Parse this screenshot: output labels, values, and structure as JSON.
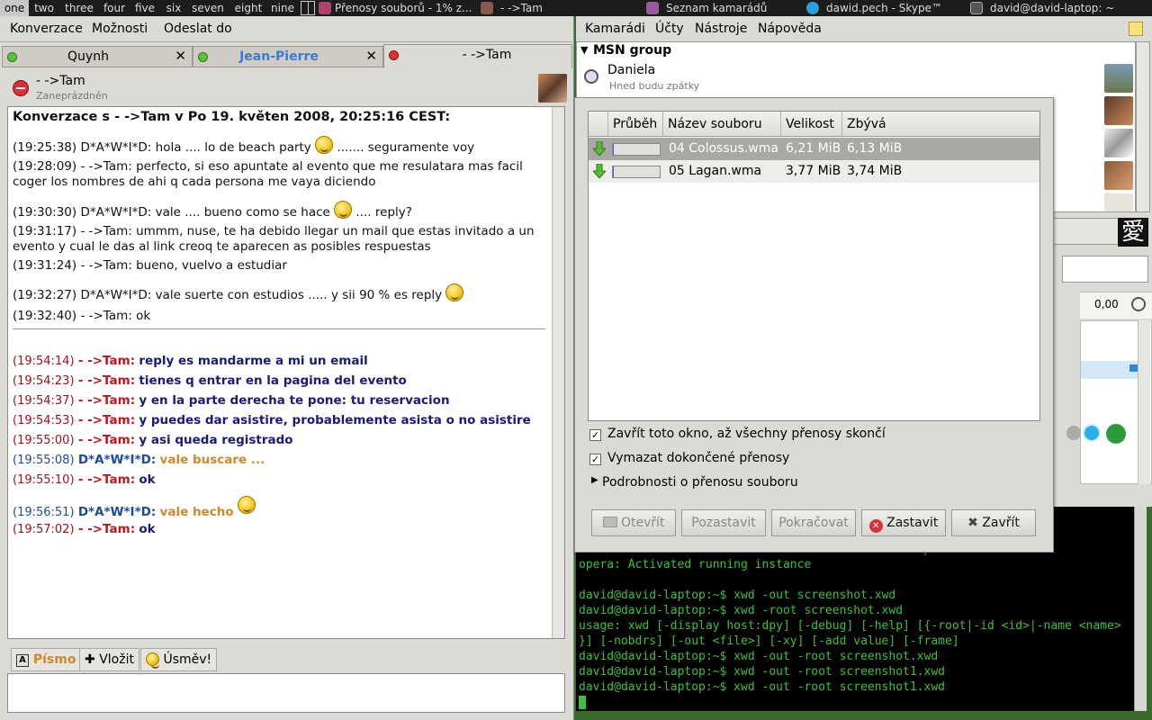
{
  "taskbar": {
    "workspaces": [
      "one",
      "two",
      "three",
      "four",
      "five",
      "six",
      "seven",
      "eight",
      "nine"
    ],
    "active_workspace": "one",
    "tasks": [
      "Přenosy souborů - 1% z...",
      "- ->Tam",
      "Seznam kamarádů",
      "dawid.pech - Skype™",
      "david@david-laptop: ~"
    ]
  },
  "chat": {
    "menu": [
      "Konverzace",
      "Možnosti",
      "Odeslat do"
    ],
    "tabs": [
      {
        "label": "Quynh"
      },
      {
        "label": "Jean-Pierre"
      },
      {
        "label": "- ->Tam"
      }
    ],
    "contact": {
      "name": "- ->Tam",
      "status": "Zaneprázdněn"
    },
    "header_line": "Konverzace s - ->Tam v Po 19. květen 2008, 20:25:16 CEST:",
    "history": [
      {
        "text": "(19:25:38) D*A*W*I*D: hola .... lo de beach party",
        "after": "....... seguramente voy",
        "smiley": true
      },
      {
        "text": "(19:28:09) - ->Tam: perfecto, si eso apuntate al evento que me resulatara mas facil coger los nombres de ahi q cada persona me vaya diciendo"
      },
      {
        "text": "(19:30:30) D*A*W*I*D: vale .... bueno como se hace",
        "after": ".... reply?",
        "smiley": true
      },
      {
        "text": "(19:31:17) - ->Tam: ummm, nuse, te ha debido llegar un mail que estas invitado a un evento y cual le das al link creoq te aparecen as posibles respuestas"
      },
      {
        "text": "(19:31:24) - ->Tam: bueno, vuelvo a estudiar"
      },
      {
        "text": "(19:32:27) D*A*W*I*D: vale suerte con estudios ..... y sii 90 % es reply",
        "smiley": true
      },
      {
        "text": "(19:32:40) - ->Tam: ok"
      }
    ],
    "messages": [
      {
        "time": "(19:54:14)",
        "nick": "- ->Tam:",
        "msg": "reply es mandarme a mi un email",
        "self": false
      },
      {
        "time": "(19:54:23)",
        "nick": "- ->Tam:",
        "msg": "tienes q entrar en la pagina del evento",
        "self": false
      },
      {
        "time": "(19:54:37)",
        "nick": "- ->Tam:",
        "msg": "y en la parte derecha te pone: tu reservacion",
        "self": false
      },
      {
        "time": "(19:54:53)",
        "nick": "- ->Tam:",
        "msg": "y puedes dar asistire, probablemente asista o no asistire",
        "self": false
      },
      {
        "time": "(19:55:00)",
        "nick": "- ->Tam:",
        "msg": "y asi queda registrado",
        "self": false
      },
      {
        "time": "(19:55:08)",
        "nick": "D*A*W*I*D:",
        "msg": "vale buscare ...",
        "self": true
      },
      {
        "time": "(19:55:10)",
        "nick": "- ->Tam:",
        "msg": "ok",
        "self": false
      },
      {
        "time": "(19:56:51)",
        "nick": "D*A*W*I*D:",
        "msg": "vale hecho",
        "self": true
      },
      {
        "time": "(19:57:02)",
        "nick": "- ->Tam:",
        "msg": "ok",
        "self": false
      }
    ],
    "toolbar": {
      "font": "Písmo",
      "insert": "Vložit",
      "smile": "Úsměv!"
    }
  },
  "buddy": {
    "menu": [
      "Kamarádi",
      "Účty",
      "Nástroje",
      "Nápověda"
    ],
    "group": "MSN group",
    "contact": {
      "name": "Daniela",
      "status": "Hned budu zpátky"
    },
    "balance": "0,00"
  },
  "dialog": {
    "columns": [
      "Průběh",
      "Název souboru",
      "Velikost",
      "Zbývá"
    ],
    "files": [
      {
        "name": "04 Colossus.wma",
        "size": "6,21 MiB",
        "remaining": "6,13 MiB",
        "progress": 0.01,
        "selected": true
      },
      {
        "name": "05 Lagan.wma",
        "size": "3,77 MiB",
        "remaining": "3,74 MiB",
        "progress": 0.01,
        "selected": false
      }
    ],
    "close_when_done": "Zavřít toto okno, až všechny přenosy skončí",
    "clear_finished": "Vymazat dokončené přenosy",
    "details": "Podrobnosti o přenosu souboru",
    "buttons": {
      "open": "Otevřít",
      "pause": "Pozastavit",
      "resume": "Pokračovat",
      "stop": "Zastavit",
      "close": "Zavřít"
    }
  },
  "terminal": {
    "lines": [
      "                                                 ported",
      "opera: Activated running instance",
      "",
      "david@david-laptop:~$ xwd -out screenshot.xwd",
      "david@david-laptop:~$ xwd -root screenshot.xwd",
      "usage: xwd [-display host:dpy] [-debug] [-help] [{-root|-id <id>|-name <name>",
      "}] [-nobdrs] [-out <file>] [-xy] [-add value] [-frame]",
      "david@david-laptop:~$ xwd -out -root screenshot.xwd",
      "david@david-laptop:~$ xwd -out -root screenshot1.xwd",
      "david@david-laptop:~$ xwd -out -root screenshot1.xwd"
    ]
  }
}
